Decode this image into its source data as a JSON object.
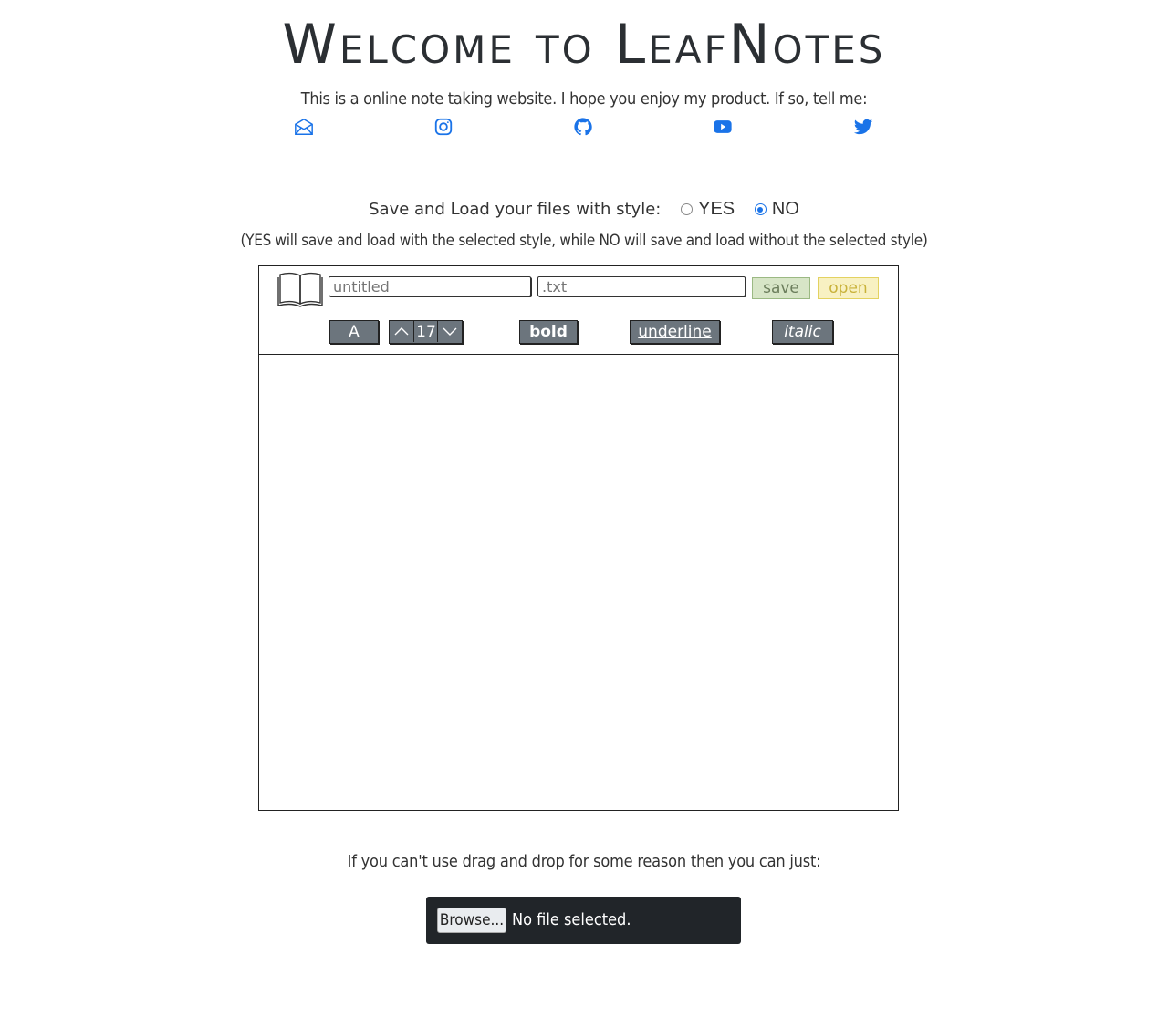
{
  "header": {
    "title": "Welcome to LeafNotes",
    "intro": "This is a online note taking website. I hope you enjoy my product. If so, tell me:"
  },
  "socials": [
    {
      "name": "email",
      "icon": "envelope-icon"
    },
    {
      "name": "instagram",
      "icon": "instagram-icon"
    },
    {
      "name": "github",
      "icon": "github-icon"
    },
    {
      "name": "youtube",
      "icon": "youtube-icon"
    },
    {
      "name": "twitter",
      "icon": "twitter-icon"
    }
  ],
  "style_option": {
    "label": "Save and Load your files with style:",
    "yes_label": "YES",
    "no_label": "NO",
    "selected": "NO",
    "note": "(YES will save and load with the selected style, while NO will save and load without the selected style)"
  },
  "editor": {
    "title_placeholder": "untitled",
    "ext_placeholder": ".txt",
    "save_label": "save",
    "open_label": "open",
    "font_label": "A",
    "font_size": "17",
    "bold_label": "bold",
    "underline_label": "underline",
    "italic_label": "italic"
  },
  "upload": {
    "message": "If you can't use drag and drop for some reason then you can just:",
    "browse_label": "Browse...",
    "status": "No file selected."
  },
  "colors": {
    "accent": "#1a73e8",
    "save_bg": "#d7e5c7",
    "open_bg": "#f8f1c2",
    "format_btn": "#6c757d",
    "file_box": "#212529"
  }
}
